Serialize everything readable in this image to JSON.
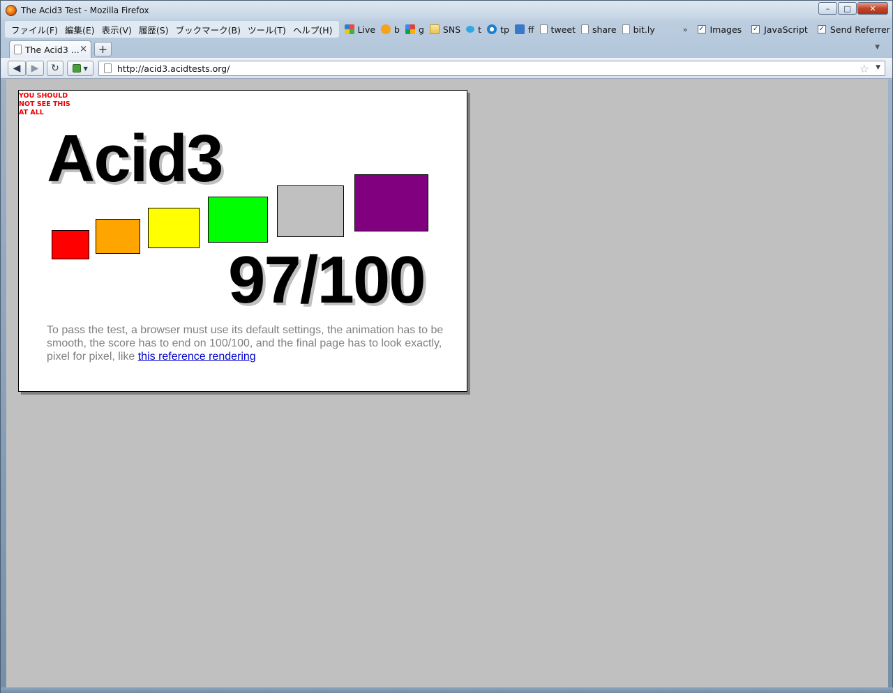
{
  "window": {
    "title": "The Acid3 Test - Mozilla Firefox",
    "minimize": "–",
    "maximize": "□",
    "close": "✕"
  },
  "menu": [
    "ファイル(F)",
    "編集(E)",
    "表示(V)",
    "履歴(S)",
    "ブックマーク(B)",
    "ツール(T)",
    "ヘルプ(H)"
  ],
  "bookmarks": [
    {
      "label": "Live",
      "icon": "windows-live-icon"
    },
    {
      "label": "b",
      "icon": "hatena-icon"
    },
    {
      "label": "g",
      "icon": "google-icon"
    },
    {
      "label": "SNS",
      "icon": "folder-icon"
    },
    {
      "label": "t",
      "icon": "twitter-icon"
    },
    {
      "label": "tp",
      "icon": "tp-icon"
    },
    {
      "label": "ff",
      "icon": "friendfeed-icon"
    },
    {
      "label": "tweet",
      "icon": "page-icon"
    },
    {
      "label": "share",
      "icon": "page-icon"
    },
    {
      "label": "bit.ly",
      "icon": "page-icon"
    }
  ],
  "overflow": "»",
  "toggles": [
    {
      "label": "Images",
      "checked": true
    },
    {
      "label": "JavaScript",
      "checked": true
    },
    {
      "label": "Send Referrer",
      "checked": true
    }
  ],
  "tab": {
    "label": "The Acid3 ...",
    "close": "×"
  },
  "newtab": "+",
  "nav": {
    "back": "◀",
    "forward": "▶",
    "reload": "↻",
    "url": "http://acid3.acidtests.org/"
  },
  "acid": {
    "warning": "YOU SHOULD NOT SEE THIS AT ALL",
    "title": "Acid3",
    "score": "97/100",
    "desc_text": "To pass the test, a browser must use its default settings, the animation has to be smooth, the score has to end on 100/100, and the final page has to look exactly, pixel for pixel, like ",
    "link_text": "this reference rendering",
    "squares": [
      {
        "color": "#ff0000"
      },
      {
        "color": "#ffa500"
      },
      {
        "color": "#ffff00"
      },
      {
        "color": "#00ff00"
      },
      {
        "color": "#c0c0c0"
      },
      {
        "color": "#800080"
      }
    ]
  }
}
